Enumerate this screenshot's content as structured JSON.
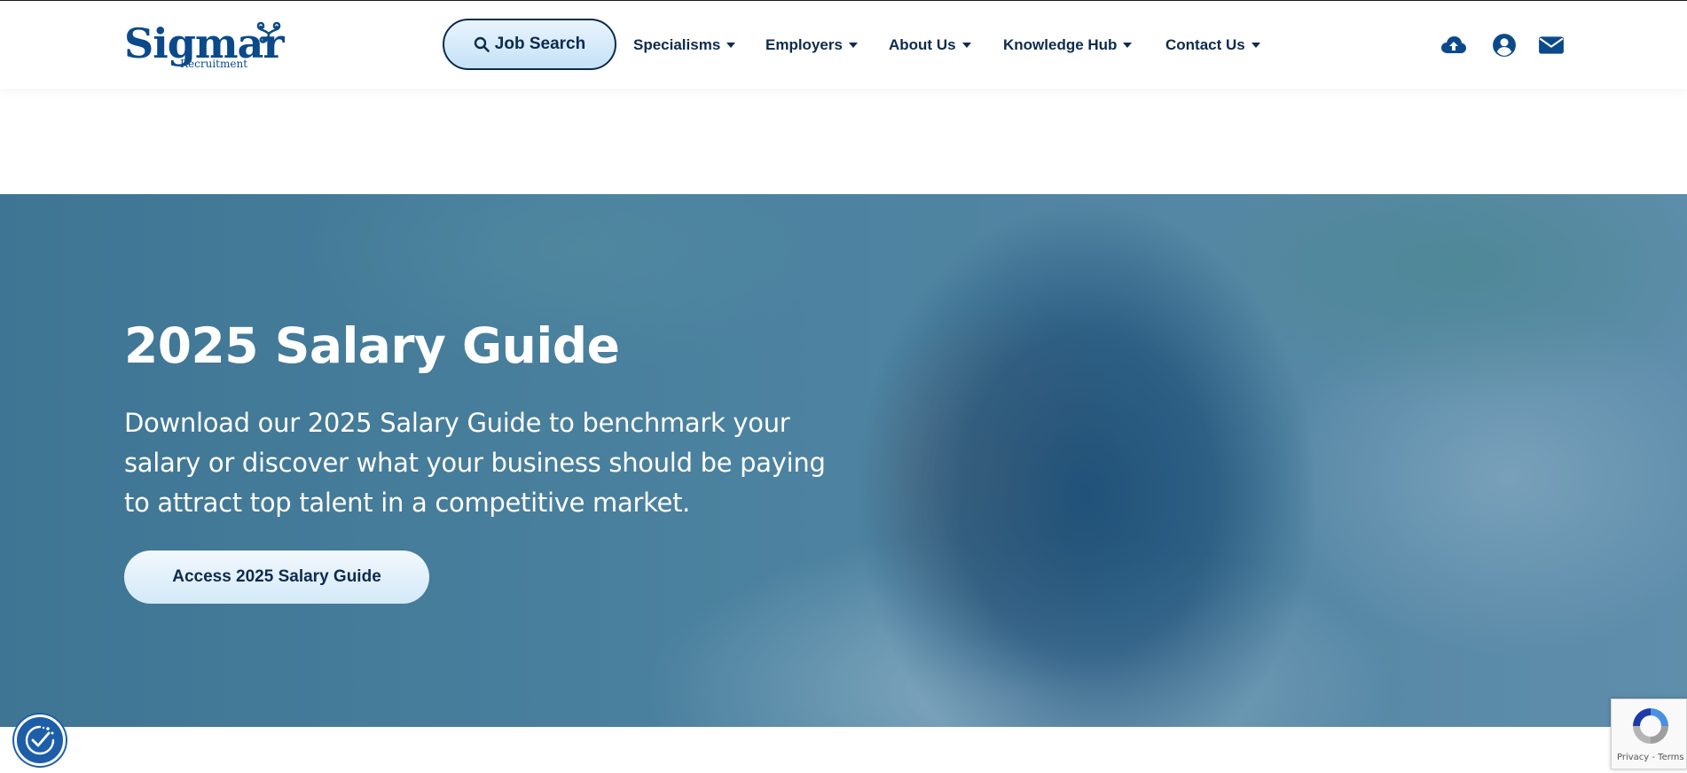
{
  "header": {
    "logo": {
      "name": "Sigmar",
      "sub": "Recruitment"
    },
    "job_search_label": "Job Search",
    "nav": [
      {
        "label": "Specialisms"
      },
      {
        "label": "Employers"
      },
      {
        "label": "About Us"
      },
      {
        "label": "Knowledge Hub"
      },
      {
        "label": "Contact Us"
      }
    ],
    "icons": [
      "upload-cv-icon",
      "account-icon",
      "email-icon"
    ]
  },
  "hero": {
    "title": "2025 Salary Guide",
    "text": "Download our 2025 Salary Guide to benchmark your salary or discover what your business should be paying to attract top talent in a competitive market.",
    "cta_label": "Access 2025 Salary Guide"
  },
  "recaptcha": {
    "links": "Privacy - Terms"
  },
  "colors": {
    "brand": "#0b4a8a",
    "navy": "#0d2b4e",
    "cta_bg": "#d3e9f8",
    "cookie_button": "#1e5ea8"
  }
}
